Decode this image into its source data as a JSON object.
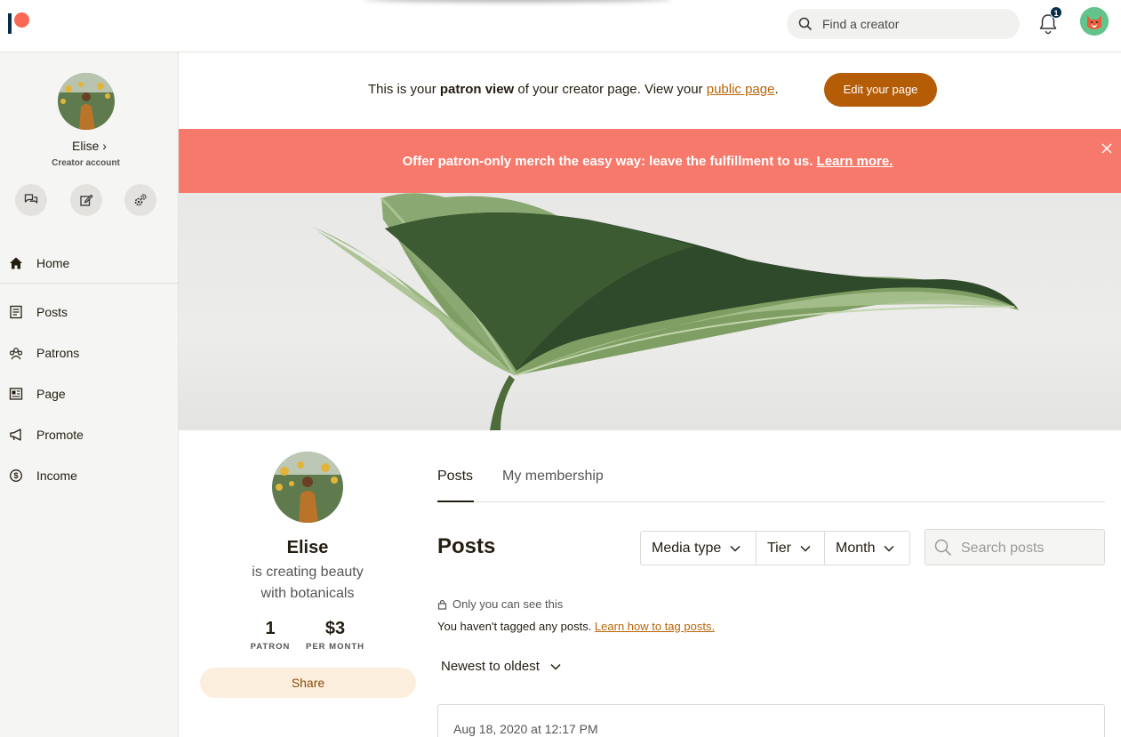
{
  "topbar": {
    "search_placeholder": "Find a creator",
    "notification_count": "1"
  },
  "sidebar": {
    "user_name": "Elise ›",
    "account_type": "Creator account",
    "nav": [
      {
        "label": "Home",
        "icon": "home-icon"
      },
      {
        "label": "Posts",
        "icon": "posts-icon"
      },
      {
        "label": "Patrons",
        "icon": "patrons-icon"
      },
      {
        "label": "Page",
        "icon": "page-icon"
      },
      {
        "label": "Promote",
        "icon": "megaphone-icon"
      },
      {
        "label": "Income",
        "icon": "dollar-icon"
      }
    ]
  },
  "notice": {
    "prefix": "This is your ",
    "bold": "patron view",
    "middle": " of your creator page. View your ",
    "link": "public page",
    "suffix": ".",
    "edit_button": "Edit your page"
  },
  "promo": {
    "text": "Offer patron-only merch the easy way: leave the fulfillment to us. ",
    "link": "Learn more."
  },
  "profile": {
    "name": "Elise",
    "description_line1": "is creating beauty",
    "description_line2": "with botanicals",
    "patrons_count": "1",
    "patrons_label": "PATRON",
    "monthly_amount": "$3",
    "monthly_label": "PER MONTH",
    "share_label": "Share"
  },
  "tabs": [
    {
      "label": "Posts",
      "active": true
    },
    {
      "label": "My membership",
      "active": false
    }
  ],
  "posts": {
    "title": "Posts",
    "filters": [
      "Media type",
      "Tier",
      "Month"
    ],
    "search_placeholder": "Search posts",
    "visibility_note": "Only you can see this",
    "untagged_text": "You haven't tagged any posts. ",
    "untagged_link": "Learn how to tag posts.",
    "sort_label": "Newest to oldest",
    "first_post_date": "Aug 18, 2020 at 12:17 PM"
  },
  "colors": {
    "brand_coral": "#f96854",
    "brand_navy": "#052d49",
    "promo_bg": "#f6796b",
    "edit_button": "#b55c07",
    "link": "#b8660a"
  }
}
